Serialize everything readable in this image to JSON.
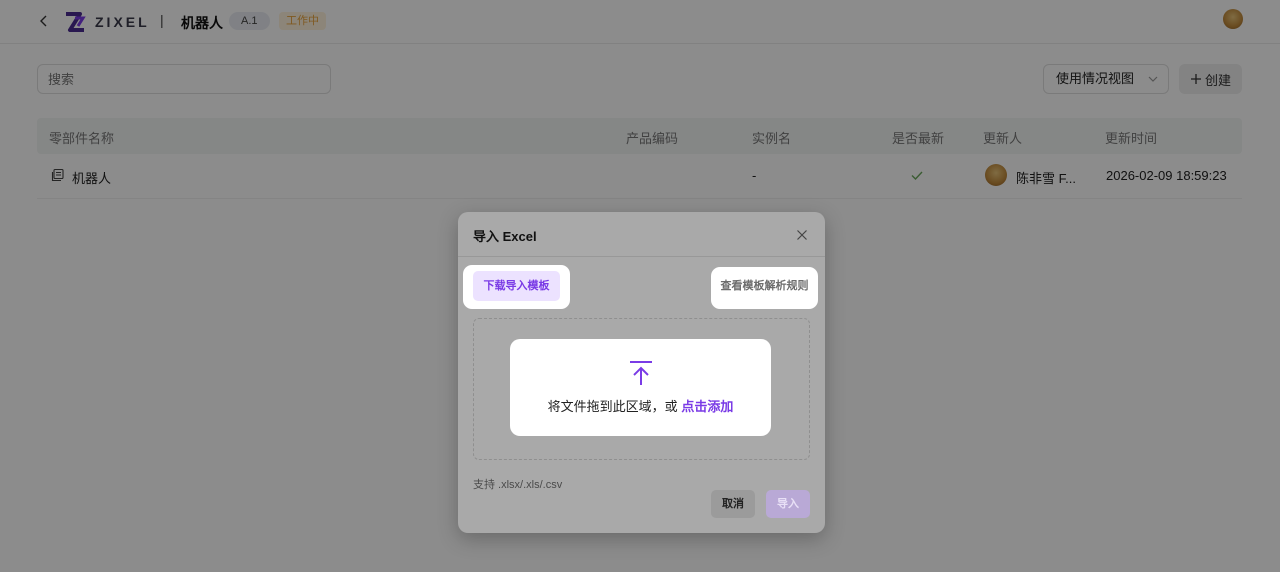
{
  "header": {
    "logo_text": "ZIXEL",
    "divider": "|",
    "title": "机器人",
    "version": "A.1",
    "status": "工作中"
  },
  "toolbar": {
    "search_placeholder": "搜索",
    "view_label": "使用情况视图",
    "create_label": "创建"
  },
  "table": {
    "columns": [
      "零部件名称",
      "产品编码",
      "实例名",
      "是否最新",
      "更新人",
      "更新时间"
    ],
    "rows": [
      {
        "name": "机器人",
        "code": "",
        "instance": "-",
        "latest": true,
        "updater": "陈非雪 F...",
        "updated": "2026-02-09 18:59:23"
      }
    ]
  },
  "modal": {
    "title": "导入 Excel",
    "download_template": "下载导入模板",
    "view_rules": "查看模板解析规则",
    "drop_text": "将文件拖到此区域，或",
    "drop_link": "点击添加",
    "support": "支持 .xlsx/.xls/.csv",
    "cancel": "取消",
    "import": "导入"
  },
  "icons": {
    "back": "chevron-left-icon",
    "view_select": "chevron-down-icon",
    "create": "plus-icon",
    "part": "part-icon",
    "latest": "check-icon",
    "close": "close-icon",
    "upload": "upload-icon"
  },
  "colors": {
    "accent": "#7a3be6",
    "status": "#e8a33c",
    "overlay": "rgba(0,0,0,0.45)"
  }
}
